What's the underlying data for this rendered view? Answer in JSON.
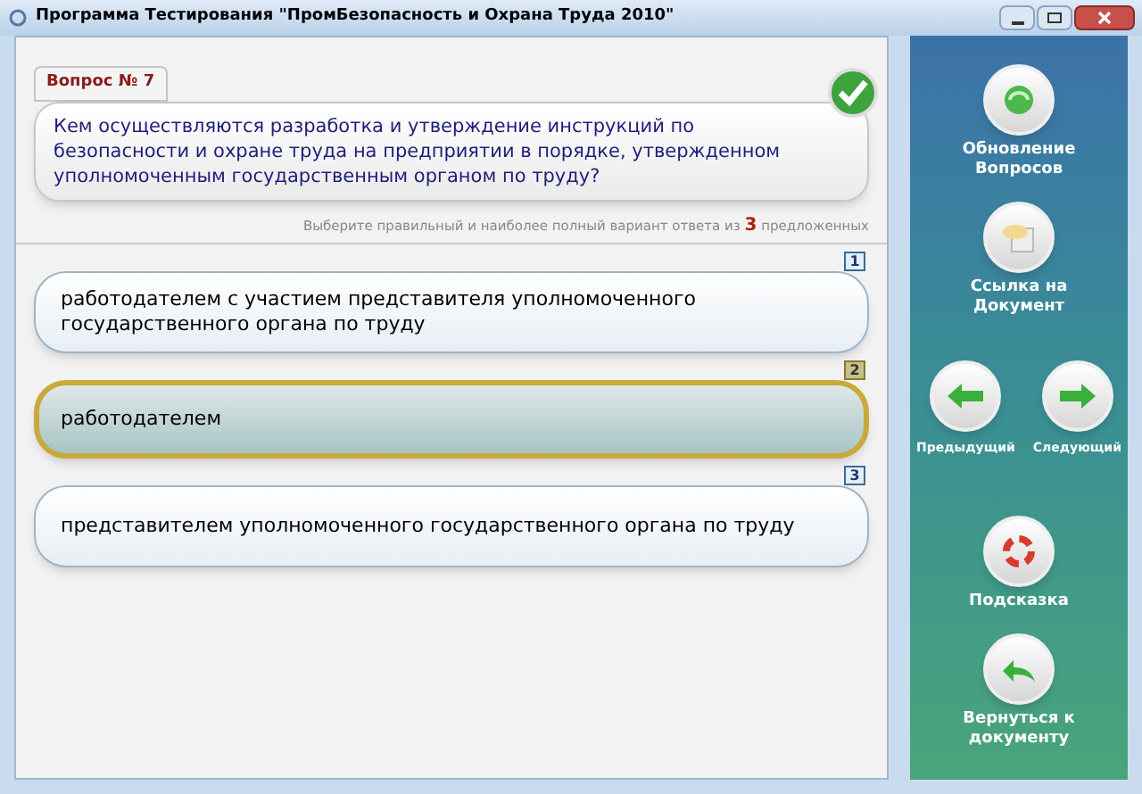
{
  "window": {
    "title": "Программа Тестирования \"ПромБезопасность и Охрана Труда 2010\""
  },
  "question": {
    "number_label": "Вопрос № 7",
    "text": "Кем осуществляются разработка и утверждение инструкций по безопасности и охране труда на предприятии в порядке, утвержденном уполномоченным государственным органом по труду?",
    "hint_before": "Выберите правильный и наиболее полный вариант ответа из",
    "count": "3",
    "hint_after": "предложенных"
  },
  "answers": [
    {
      "number": "1",
      "text": "работодателем с участием представителя уполномоченного государственного органа по труду",
      "selected": false
    },
    {
      "number": "2",
      "text": "работодателем",
      "selected": true
    },
    {
      "number": "3",
      "text": "представителем уполномоченного государственного органа по труду",
      "selected": false
    }
  ],
  "sidebar": [
    {
      "kind": "refresh",
      "label": "Обновление Вопросов"
    },
    {
      "kind": "document",
      "label": "Ссылка на Документ"
    },
    {
      "kind": "nav",
      "buttons": [
        {
          "kind": "prev",
          "label": "Предыдущий"
        },
        {
          "kind": "next",
          "label": "Следующий"
        }
      ]
    },
    {
      "kind": "hint",
      "label": "Подсказка"
    },
    {
      "kind": "back",
      "label": "Вернуться к документу"
    }
  ]
}
